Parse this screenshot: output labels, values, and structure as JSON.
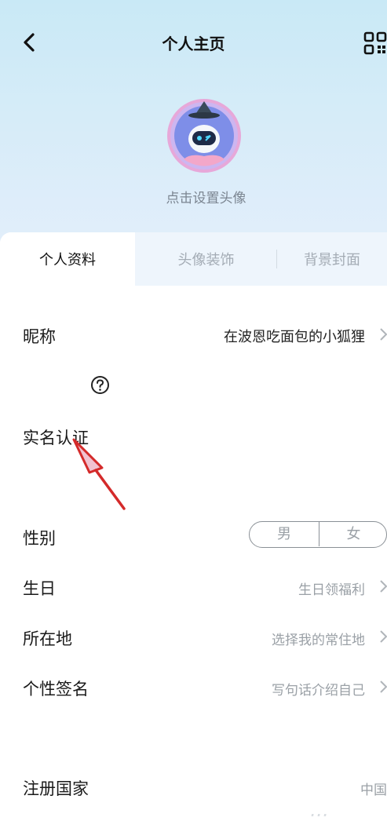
{
  "header": {
    "title": "个人主页",
    "avatar_hint": "点击设置头像"
  },
  "tabs": [
    {
      "label": "个人资料",
      "active": true
    },
    {
      "label": "头像装饰",
      "active": false
    },
    {
      "label": "背景封面",
      "active": false
    }
  ],
  "profile": {
    "nickname": {
      "label": "昵称",
      "value": "在波恩吃面包的小狐狸"
    },
    "real_name": {
      "label": "实名认证"
    },
    "gender": {
      "label": "性别",
      "options": [
        "男",
        "女"
      ]
    },
    "birthday": {
      "label": "生日",
      "value": "生日领福利"
    },
    "location": {
      "label": "所在地",
      "value": "选择我的常住地"
    },
    "signature": {
      "label": "个性签名",
      "value": "写句话介绍自己"
    },
    "country": {
      "label": "注册国家",
      "value": "中国"
    }
  },
  "watermark": "…",
  "colors": {
    "header_gradient_top": "#c9e9f6",
    "header_gradient_bottom": "#e3eefb",
    "annotation_arrow": "#d42a2a",
    "muted_text": "#9aa0a6"
  },
  "icons": {
    "back": "chevron-left-icon",
    "qr": "qr-code-icon",
    "help": "question-circle-icon",
    "row_chevron": "chevron-right-icon"
  }
}
